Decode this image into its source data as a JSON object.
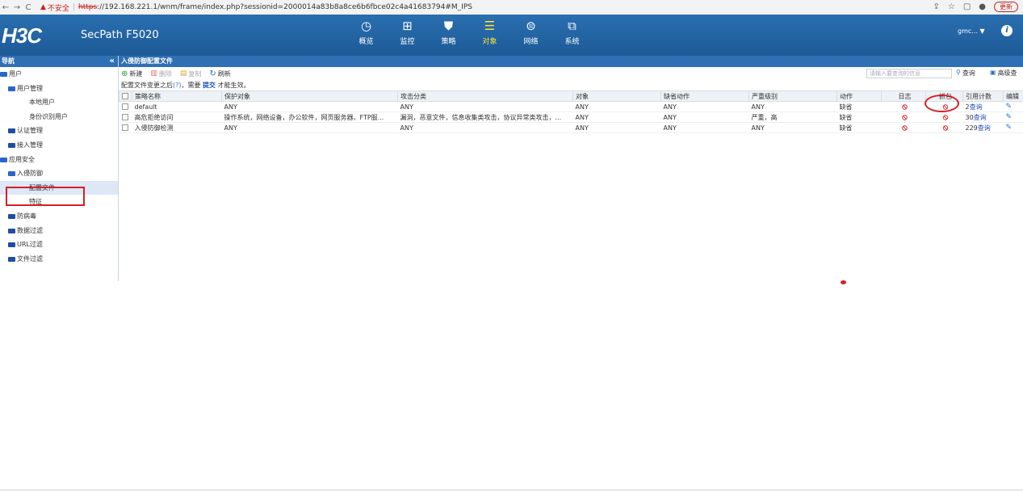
{
  "browser": {
    "back": "←",
    "forward": "→",
    "reload": "C",
    "warning": "不安全",
    "url_scheme": "https",
    "url_rest": "://192.168.221.1/wnm/frame/index.php?sessionid=2000014a83b8a8ce6b6fbce02c4a41683794#M_IPS",
    "update": "更新"
  },
  "header": {
    "logo": "H3C",
    "product": "SecPath F5020",
    "nav": [
      {
        "label": "概览",
        "icon": "gauge-icon"
      },
      {
        "label": "监控",
        "icon": "monitor-icon"
      },
      {
        "label": "策略",
        "icon": "shield-icon"
      },
      {
        "label": "对象",
        "icon": "object-stack-icon",
        "active": true
      },
      {
        "label": "网络",
        "icon": "internet-icon"
      },
      {
        "label": "系统",
        "icon": "code-window-icon"
      }
    ],
    "user": "gmc... ▼",
    "info": "i"
  },
  "sidebar": {
    "title": "导航",
    "collapse": "«",
    "items": [
      {
        "label": "用户",
        "level": 0,
        "folder": "open"
      },
      {
        "label": "用户管理",
        "level": 1,
        "folder": "open"
      },
      {
        "label": "本地用户",
        "level": 2
      },
      {
        "label": "身份识别用户",
        "level": 2
      },
      {
        "label": "认证管理",
        "level": 1,
        "folder": "closed"
      },
      {
        "label": "接入管理",
        "level": 1,
        "folder": "closed"
      },
      {
        "label": "应用安全",
        "level": 0,
        "folder": "open"
      },
      {
        "label": "入侵防御",
        "level": 1,
        "folder": "open"
      },
      {
        "label": "配置文件",
        "level": 2,
        "selected": true
      },
      {
        "label": "特征",
        "level": 2
      },
      {
        "label": "防病毒",
        "level": 1,
        "folder": "closed"
      },
      {
        "label": "数据过滤",
        "level": 1,
        "folder": "closed"
      },
      {
        "label": "URL过滤",
        "level": 1,
        "folder": "closed"
      },
      {
        "label": "文件过滤",
        "level": 1,
        "folder": "closed"
      }
    ]
  },
  "main": {
    "title": "入侵防御配置文件",
    "toolbar": {
      "new": "新建",
      "delete": "删除",
      "copy": "复制",
      "refresh": "刷新",
      "search_placeholder": "请输入要查询的信息",
      "search": "查询",
      "advanced": "高级查"
    },
    "hint": {
      "before": "配置文件变更之后",
      "help": "?",
      "mid": "，需要 ",
      "submit": "提交",
      "after": " 才能生效。"
    },
    "columns": [
      "策略名称",
      "保护对象",
      "攻击分类",
      "对象",
      "缺省动作",
      "严重级别",
      "动作",
      "日志",
      "抓包",
      "引用计数",
      "编辑"
    ],
    "rows": [
      {
        "name": "default",
        "protect": "ANY",
        "attack": "ANY",
        "object": "ANY",
        "default_action": "ANY",
        "severity": "ANY",
        "action": "缺省",
        "count": "2",
        "query": "查询"
      },
      {
        "name": "高危拒绝访问",
        "protect": "操作系统，网络设备，办公软件，网页服务器，FTP服...",
        "attack": "漏洞，恶意文件，信息收集类攻击，协议异常类攻击，...",
        "object": "ANY",
        "default_action": "ANY",
        "severity": "严重，高",
        "action": "缺省",
        "count": "30",
        "query": "查询"
      },
      {
        "name": "入侵防御检测",
        "protect": "ANY",
        "attack": "ANY",
        "object": "ANY",
        "default_action": "ANY",
        "severity": "ANY",
        "action": "缺省",
        "count": "229",
        "query": "查询"
      }
    ]
  },
  "colors": {
    "header": "#1d5a97",
    "accent_red": "#d61f26",
    "active_nav": "#ffe23a"
  }
}
